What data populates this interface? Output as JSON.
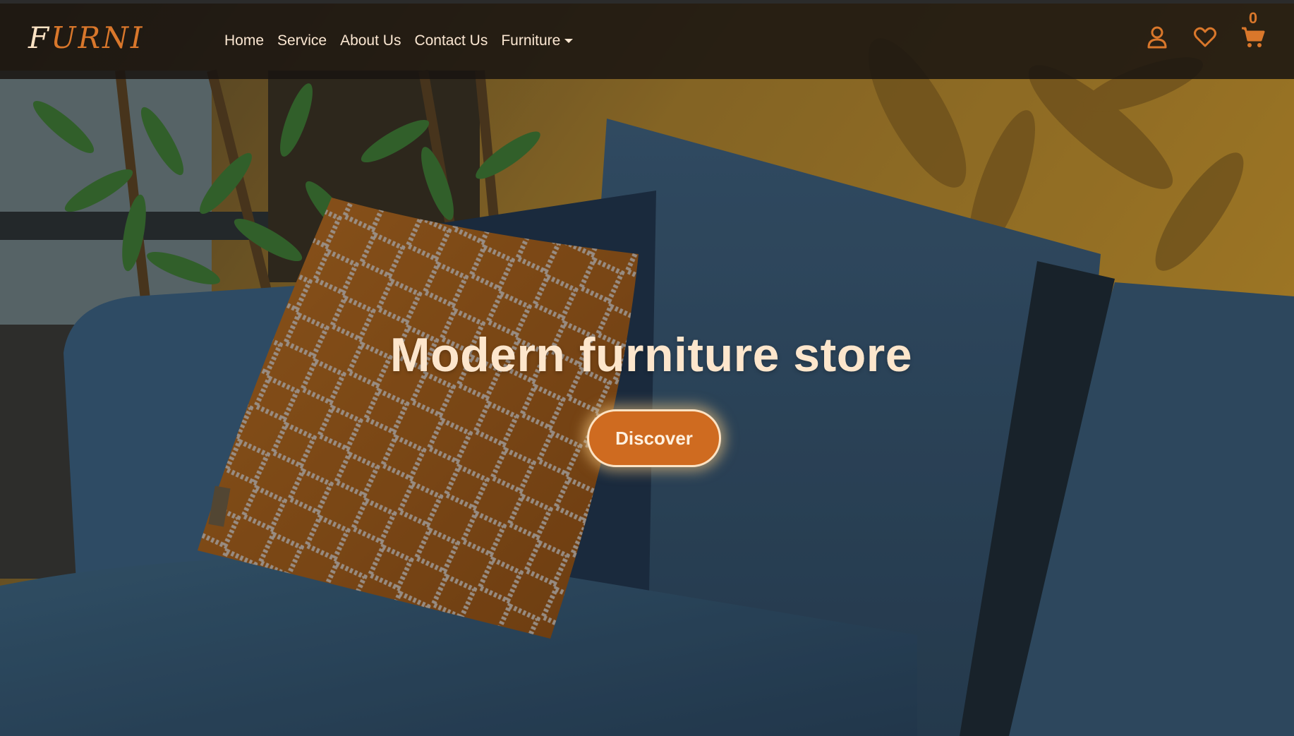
{
  "brand": {
    "first_letter": "F",
    "rest": "URNI"
  },
  "nav": {
    "items": [
      {
        "label": "Home"
      },
      {
        "label": "Service"
      },
      {
        "label": "About Us"
      },
      {
        "label": "Contact Us"
      },
      {
        "label": "Furniture",
        "dropdown": true
      }
    ]
  },
  "header_icons": {
    "user": "user-icon",
    "wishlist": "heart-icon",
    "cart": "cart-icon",
    "cart_count": "0"
  },
  "hero": {
    "title": "Modern furniture store",
    "cta_label": "Discover",
    "background": "sofa-with-pillow-photo"
  },
  "colors": {
    "accent": "#d9772b",
    "cta_fill": "#cf6b20",
    "text_light": "#fde6cc",
    "navbar_bg": "#181410"
  }
}
